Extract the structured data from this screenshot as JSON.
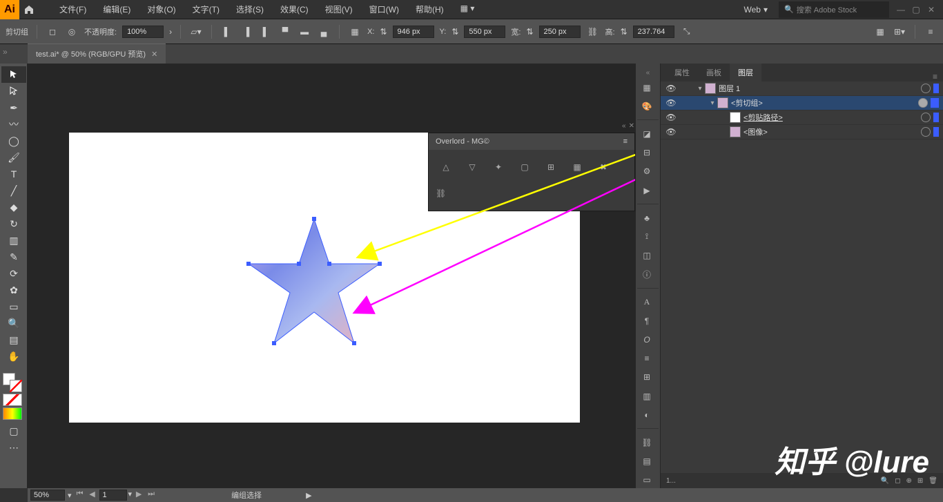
{
  "app": {
    "name": "Ai"
  },
  "menu": {
    "items": [
      "文件(F)",
      "编辑(E)",
      "对象(O)",
      "文字(T)",
      "选择(S)",
      "效果(C)",
      "视图(V)",
      "窗口(W)",
      "帮助(H)"
    ]
  },
  "profile": {
    "label": "Web"
  },
  "search": {
    "placeholder": "搜索 Adobe Stock"
  },
  "controlbar": {
    "selection_label": "剪切组",
    "opacity_label": "不透明度:",
    "opacity_value": "100%",
    "x_label": "X:",
    "x_value": "946 px",
    "y_label": "Y:",
    "y_value": "550 px",
    "w_label": "宽:",
    "w_value": "250 px",
    "h_label": "高:",
    "h_value": "237.764"
  },
  "tab": {
    "title": "test.ai* @ 50% (RGB/GPU 预览)"
  },
  "overlord": {
    "title": "Overlord - MG©"
  },
  "panels": {
    "tabs": [
      "属性",
      "画板",
      "图层"
    ],
    "active": 2
  },
  "layers": [
    {
      "name": "图层 1",
      "indent": 0,
      "expanded": true,
      "selected": false,
      "underline": false,
      "thumb": "#d0b0d0"
    },
    {
      "name": "<剪切组>",
      "indent": 1,
      "expanded": true,
      "selected": true,
      "underline": false,
      "thumb": "#d0b0d0"
    },
    {
      "name": "<剪贴路径>",
      "indent": 2,
      "expanded": false,
      "selected": false,
      "underline": true,
      "thumb": "#fff"
    },
    {
      "name": "<图像>",
      "indent": 2,
      "expanded": false,
      "selected": false,
      "underline": false,
      "thumb": "#d0b0d0"
    }
  ],
  "layer_footer": {
    "count": "1..."
  },
  "status": {
    "zoom": "50%",
    "page": "1",
    "mode": "编组选择"
  },
  "watermark": "知乎 @lure"
}
